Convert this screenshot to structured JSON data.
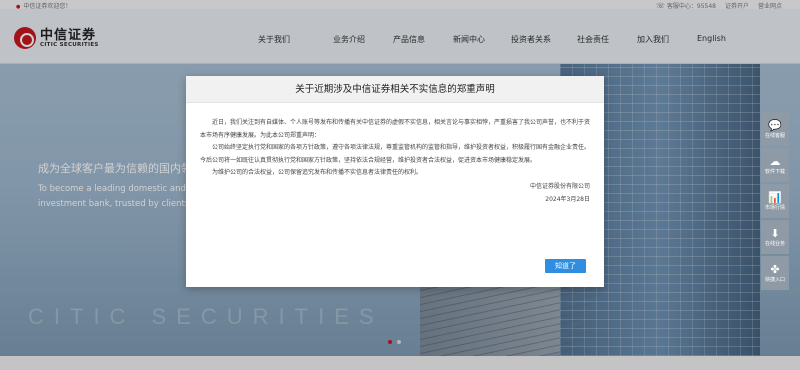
{
  "topbar": {
    "welcome": "中信证券欢迎您！",
    "hotline_label": "客服中心：95548",
    "account_link": "证券开户",
    "outlet_link": "营业网点"
  },
  "header": {
    "logo_cn": "中信证券",
    "logo_en": "CITIC SECURITIES",
    "nav": [
      "关于我们",
      "业务介绍",
      "产品信息",
      "新闻中心",
      "投资者关系",
      "社会责任",
      "加入我们",
      "English"
    ]
  },
  "hero": {
    "slogan_cn": "成为全球客户最为信赖的国内领",
    "slogan_en": "To become a leading domestic and investment bank, trusted by clients",
    "watermark": "CITIC SECURITIES"
  },
  "sidetools": [
    {
      "icon": "chat-icon",
      "glyph": "💬",
      "label": "在线客服"
    },
    {
      "icon": "cloud-download-icon",
      "glyph": "☁",
      "label": "软件下载"
    },
    {
      "icon": "chart-icon",
      "glyph": "📊",
      "label": "市场行情"
    },
    {
      "icon": "download-icon",
      "glyph": "⬇",
      "label": "在线业务"
    },
    {
      "icon": "share-icon",
      "glyph": "✤",
      "label": "快捷入口"
    }
  ],
  "modal": {
    "title": "关于近期涉及中信证券相关不实信息的郑重声明",
    "paragraphs": [
      "近日，我们关注到有自媒体、个人账号等发布和传播有关中信证券的虚假不实信息，相关言论与事实相悖，严重损害了我公司声誉，也不利于资本市场有序健康发展。为此本公司郑重声明：",
      "公司始终坚定执行党和国家的各项方针政策，遵守各项法律法规，尊重监管机构的监管和指导，维护投资者权益，积极履行国有金融企业责任。今后公司将一如既往认真贯彻执行党和国家方针政策，坚持依法合规经营，维护投资者合法权益，促进资本市场健康稳定发展。",
      "为维护公司的合法权益，公司保留追究发布和传播不实信息者法律责任的权利。"
    ],
    "company": "中信证券股份有限公司",
    "date": "2024年3月28日",
    "confirm_label": "知道了"
  }
}
